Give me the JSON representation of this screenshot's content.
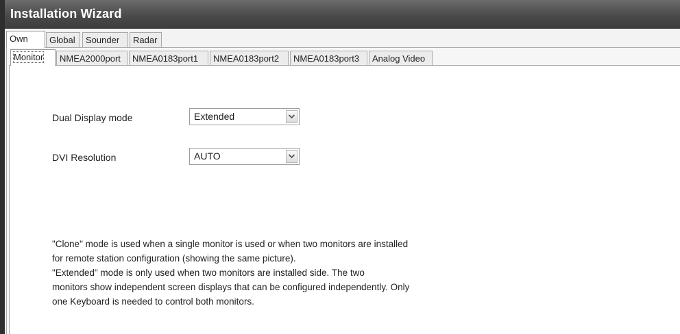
{
  "window": {
    "title": "Installation Wizard"
  },
  "outer_tabs": [
    "Own",
    "Global",
    "Sounder",
    "Radar"
  ],
  "inner_tabs": [
    "Monitor",
    "NMEA2000port",
    "NMEA0183port1",
    "NMEA0183port2",
    "NMEA0183port3",
    "Analog Video"
  ],
  "form": {
    "dual_display_label": "Dual Display mode",
    "dual_display_value": "Extended",
    "dvi_resolution_label": "DVI Resolution",
    "dvi_resolution_value": "AUTO"
  },
  "help": {
    "lines": [
      "\"Clone\" mode is used when a single monitor is used or when two monitors are installed",
      "for remote station configuration (showing the same picture).",
      "\"Extended\" mode is only used when two monitors are installed side. The two",
      "monitors show independent screen displays that can be configured independently. Only",
      "one Keyboard is needed to control both monitors."
    ]
  },
  "icons": {
    "dropdown": "chevron-down-icon"
  }
}
